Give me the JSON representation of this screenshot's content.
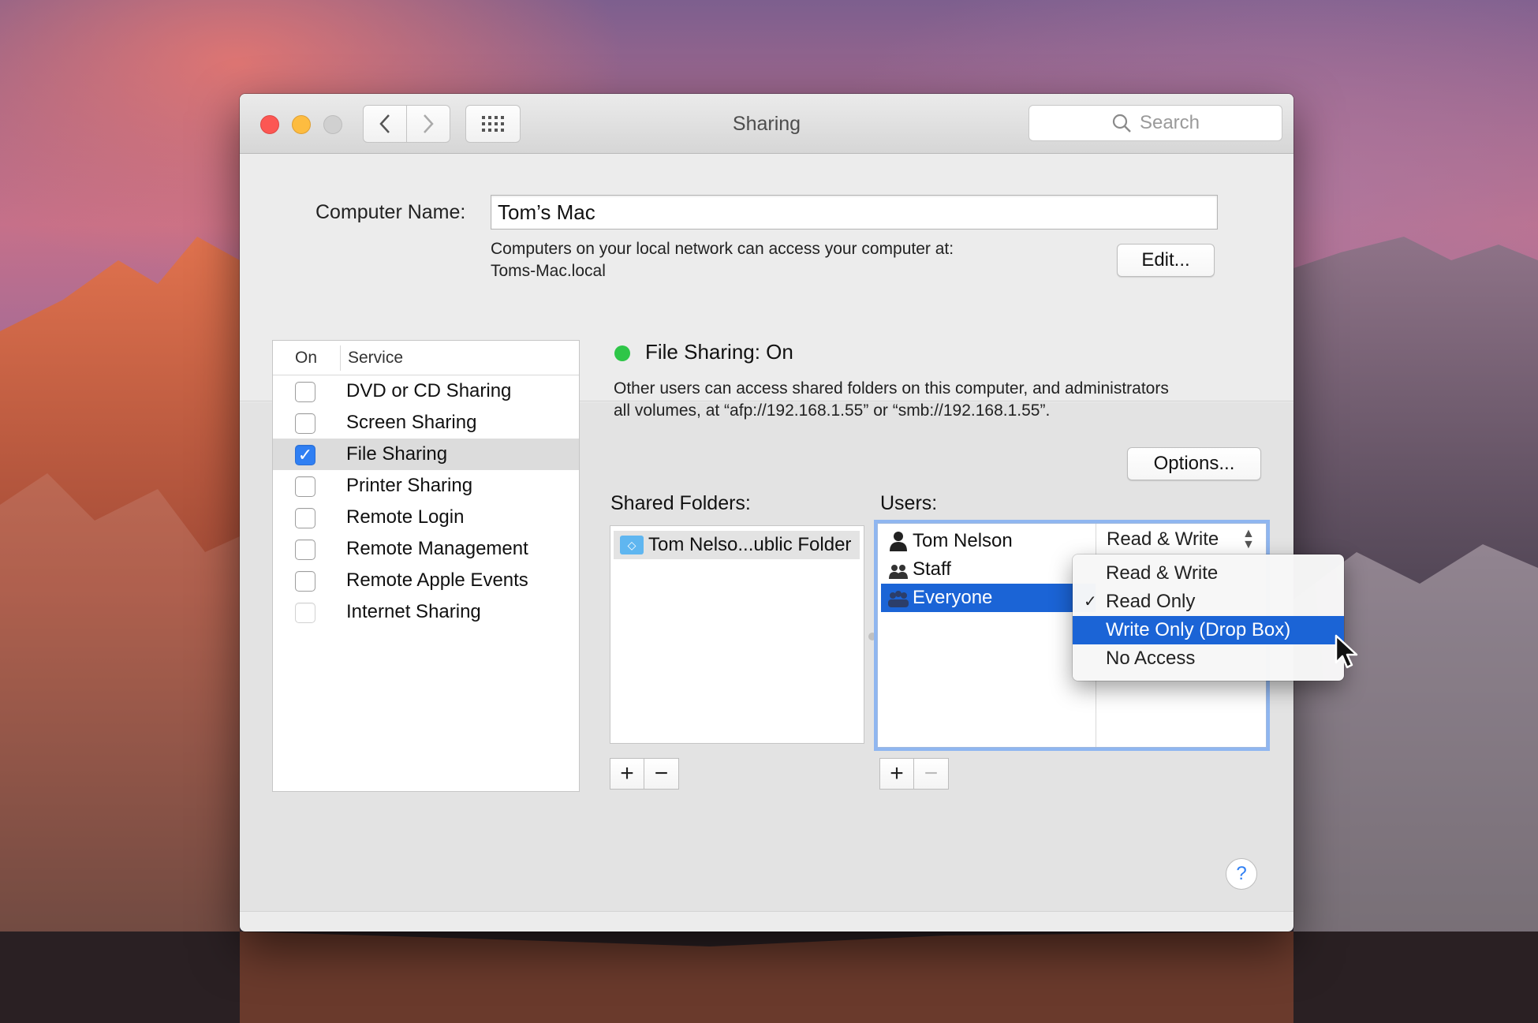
{
  "window": {
    "title": "Sharing",
    "search_placeholder": "Search"
  },
  "computer_name": {
    "label": "Computer Name:",
    "value": "Tom’s Mac",
    "desc_line1": "Computers on your local network can access your computer at:",
    "desc_line2": "Toms-Mac.local",
    "edit_label": "Edit..."
  },
  "services": {
    "header_on": "On",
    "header_service": "Service",
    "items": [
      {
        "label": "DVD or CD Sharing",
        "checked": false
      },
      {
        "label": "Screen Sharing",
        "checked": false
      },
      {
        "label": "File Sharing",
        "checked": true
      },
      {
        "label": "Printer Sharing",
        "checked": false
      },
      {
        "label": "Remote Login",
        "checked": false
      },
      {
        "label": "Remote Management",
        "checked": false
      },
      {
        "label": "Remote Apple Events",
        "checked": false
      },
      {
        "label": "Internet Sharing",
        "checked": false
      }
    ]
  },
  "detail": {
    "status": "File Sharing: On",
    "status_color": "#2ec648",
    "info_line1": "Other users can access shared folders on this computer, and administrators",
    "info_line2": "all volumes, at “afp://192.168.1.55” or “smb://192.168.1.55”.",
    "options_label": "Options...",
    "shared_folders_label": "Shared Folders:",
    "users_label": "Users:",
    "shared_folders": [
      "Tom Nelso...ublic Folder"
    ],
    "users": [
      {
        "name": "Tom Nelson",
        "icon": "user-icon"
      },
      {
        "name": "Staff",
        "icon": "group-icon"
      },
      {
        "name": "Everyone",
        "icon": "everyone-icon"
      }
    ],
    "tom_permission": "Read & Write",
    "add_label": "+",
    "remove_label": "−"
  },
  "permission_menu": {
    "items": [
      {
        "label": "Read & Write",
        "checked": false
      },
      {
        "label": "Read Only",
        "checked": true
      },
      {
        "label": "Write Only (Drop Box)",
        "checked": false,
        "highlighted": true
      },
      {
        "label": "No Access",
        "checked": false
      }
    ],
    "check_glyph": "✓"
  },
  "help_label": "?",
  "accent_color": "#1b64d6"
}
